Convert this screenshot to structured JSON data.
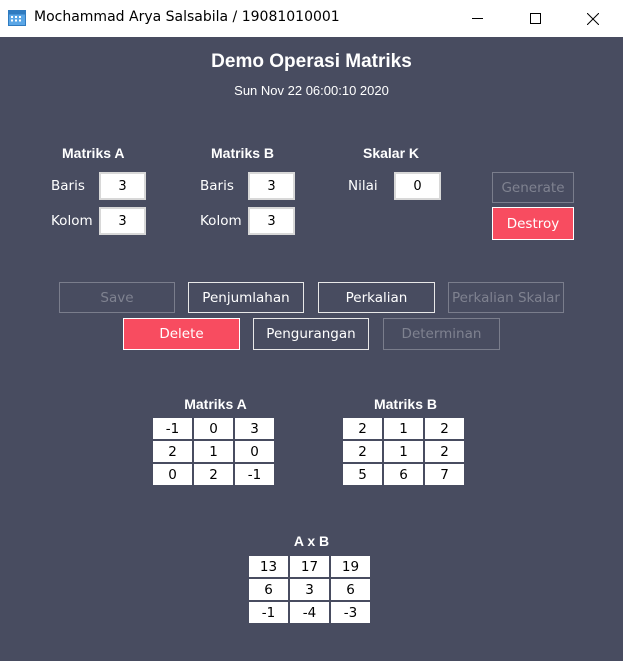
{
  "window": {
    "title": "Mochammad Arya Salsabila / 19081010001",
    "icon": "app-calendar-icon",
    "controls": [
      "minimize-icon",
      "maximize-icon",
      "close-icon"
    ]
  },
  "header": {
    "title": "Demo Operasi Matriks",
    "datetime": "Sun Nov 22 06:00:10 2020"
  },
  "inputs": {
    "matrix_a": {
      "label": "Matriks A",
      "rows_label": "Baris",
      "rows_value": "3",
      "cols_label": "Kolom",
      "cols_value": "3"
    },
    "matrix_b": {
      "label": "Matriks B",
      "rows_label": "Baris",
      "rows_value": "3",
      "cols_label": "Kolom",
      "cols_value": "3"
    },
    "scalar": {
      "label": "Skalar K",
      "value_label": "Nilai",
      "value": "0"
    }
  },
  "buttons": {
    "generate": "Generate",
    "destroy": "Destroy",
    "save": "Save",
    "penjumlahan": "Penjumlahan",
    "perkalian": "Perkalian",
    "perkalian_skalar": "Perkalian Skalar",
    "delete": "Delete",
    "pengurangan": "Pengurangan",
    "determinan": "Determinan"
  },
  "colors": {
    "background": "#484c60",
    "accent_red": "#f84c60",
    "disabled_text": "#7f8290"
  },
  "matrices": {
    "a": {
      "title": "Matriks A",
      "rows": [
        [
          "-1",
          "0",
          "3"
        ],
        [
          "2",
          "1",
          "0"
        ],
        [
          "0",
          "2",
          "-1"
        ]
      ]
    },
    "b": {
      "title": "Matriks B",
      "rows": [
        [
          "2",
          "1",
          "2"
        ],
        [
          "2",
          "1",
          "2"
        ],
        [
          "5",
          "6",
          "7"
        ]
      ]
    },
    "result": {
      "title": "A x B",
      "rows": [
        [
          "13",
          "17",
          "19"
        ],
        [
          "6",
          "3",
          "6"
        ],
        [
          "-1",
          "-4",
          "-3"
        ]
      ]
    }
  }
}
